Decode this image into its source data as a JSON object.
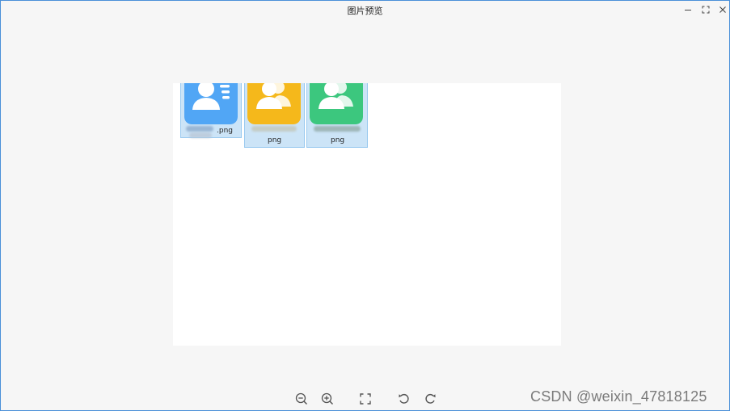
{
  "window": {
    "title": "图片预览",
    "controls": {
      "minimize_icon": "minimize-icon",
      "maximize_icon": "maximize-icon",
      "close_icon": "close-icon"
    },
    "accent_color": "#4a90d9"
  },
  "files": [
    {
      "visible_name": ".png",
      "icon": "contact-card-icon",
      "icon_color": "#51a6f5"
    },
    {
      "visible_name": "png",
      "icon": "group-users-icon",
      "icon_color": "#f5b81b"
    },
    {
      "visible_name": "png",
      "icon": "group-users-icon",
      "icon_color": "#3cc77e"
    }
  ],
  "toolbar": {
    "items": [
      {
        "name": "zoom-out",
        "icon": "zoom-out-icon"
      },
      {
        "name": "zoom-in",
        "icon": "zoom-in-icon"
      },
      {
        "name": "fit-to-window",
        "icon": "fit-screen-icon"
      },
      {
        "name": "rotate-left",
        "icon": "rotate-left-icon"
      },
      {
        "name": "rotate-right",
        "icon": "rotate-right-icon"
      }
    ]
  },
  "watermark": "CSDN @weixin_47818125"
}
